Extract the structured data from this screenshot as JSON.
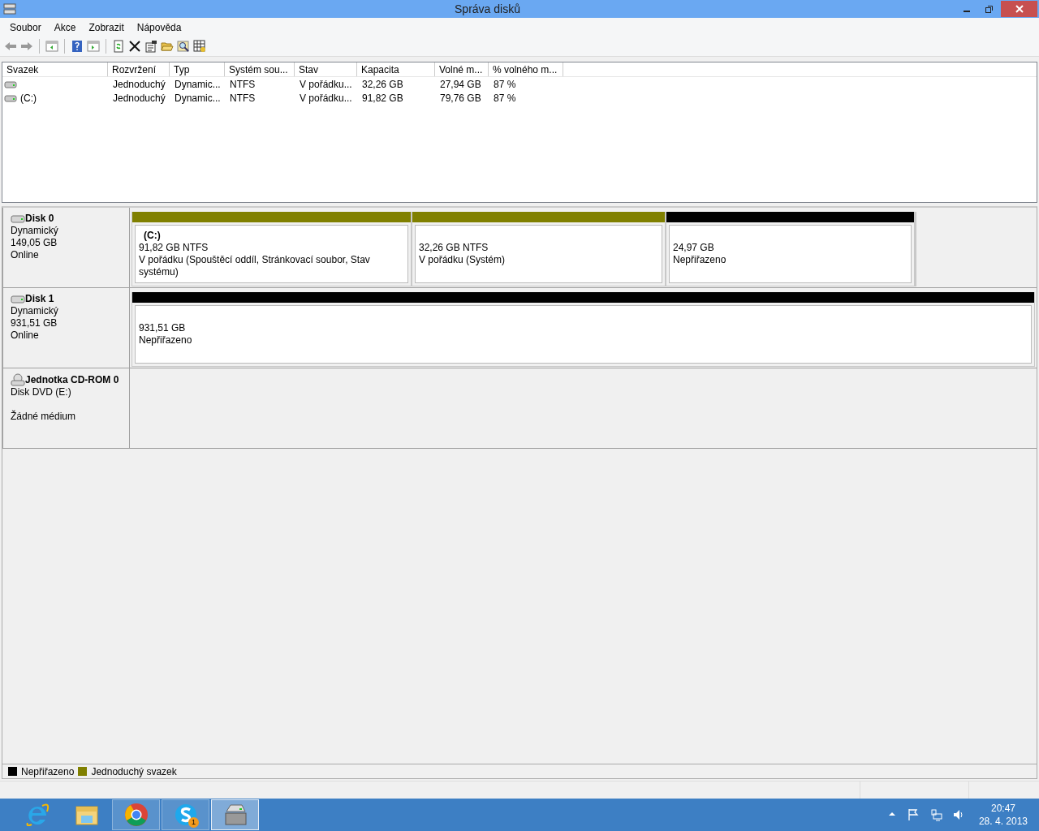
{
  "window": {
    "title": "Správa disků"
  },
  "menu": [
    "Soubor",
    "Akce",
    "Zobrazit",
    "Nápověda"
  ],
  "volume_table": {
    "columns": [
      "Svazek",
      "Rozvržení",
      "Typ",
      "Systém sou...",
      "Stav",
      "Kapacita",
      "Volné m...",
      "% volného m..."
    ],
    "rows": [
      {
        "layout": "Jednoduchý",
        "type": "Dynamic...",
        "filesystem": "NTFS",
        "status": "V pořádku...",
        "capacity": "32,26 GB",
        "free": "27,94 GB",
        "free_percent": "87 %"
      },
      {
        "volume": "(C:)",
        "layout": "Jednoduchý",
        "type": "Dynamic...",
        "filesystem": "NTFS",
        "status": "V pořádku...",
        "capacity": "91,82 GB",
        "free": "79,76 GB",
        "free_percent": "87 %"
      }
    ]
  },
  "disks": [
    {
      "kind": "disk",
      "name": "Disk 0",
      "type": "Dynamický",
      "size": "149,05 GB",
      "state": "Online",
      "partitions": [
        {
          "label": "(C:)",
          "size": "91,82 GB NTFS",
          "status": "V pořádku (Spouštěcí oddíl, Stránkovací soubor, Stav systému)",
          "color": "#808000"
        },
        {
          "size": "32,26 GB NTFS",
          "status": "V pořádku (Systém)",
          "color": "#808000"
        },
        {
          "size": "24,97 GB",
          "status": "Nepřiřazeno",
          "color": "#000000"
        }
      ]
    },
    {
      "kind": "disk",
      "name": "Disk 1",
      "type": "Dynamický",
      "size": "931,51 GB",
      "state": "Online",
      "partitions": [
        {
          "size": "931,51 GB",
          "status": "Nepřiřazeno",
          "color": "#000000"
        }
      ]
    },
    {
      "kind": "cdrom",
      "name": "Jednotka CD-ROM 0",
      "type": "Disk DVD (E:)",
      "state": "Žádné médium"
    }
  ],
  "legend": [
    {
      "label": "Nepřiřazeno",
      "color": "#000000"
    },
    {
      "label": "Jednoduchý svazek",
      "color": "#808000"
    }
  ],
  "taskbar": {
    "buttons": [
      {
        "running": false,
        "selected": false
      },
      {
        "running": false,
        "selected": false
      },
      {
        "running": true,
        "selected": false
      },
      {
        "running": true,
        "selected": false,
        "badge": "1"
      },
      {
        "running": true,
        "selected": true
      }
    ],
    "time": "20:47",
    "date": "28. 4. 2013"
  }
}
